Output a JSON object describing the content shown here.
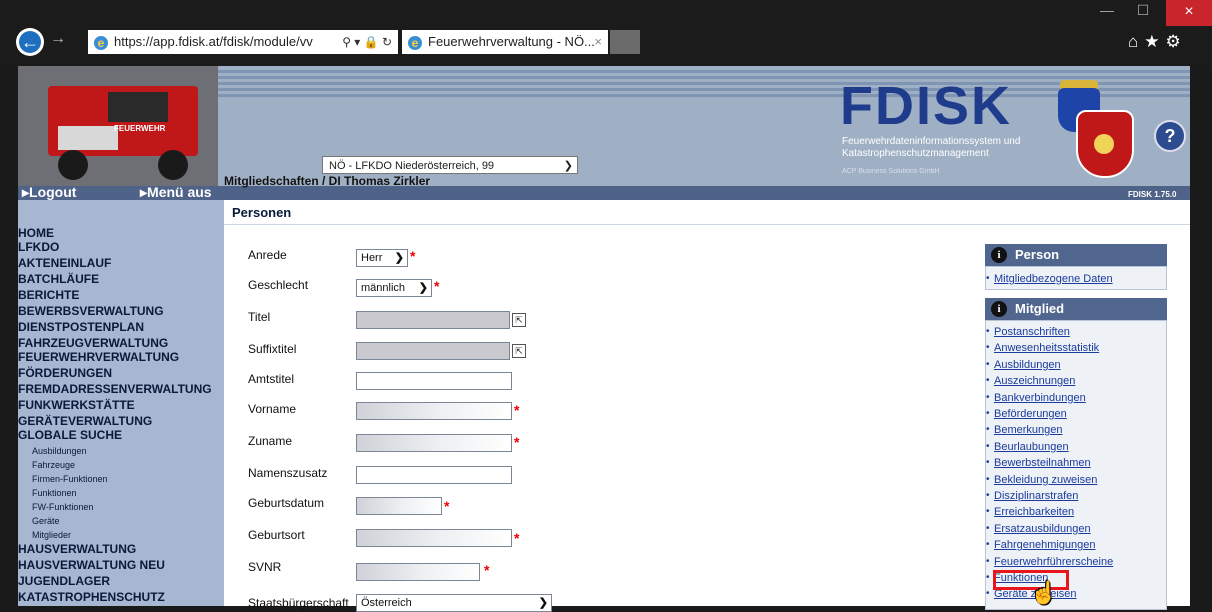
{
  "browser": {
    "url": "https://app.fdisk.at/fdisk/module/vv",
    "tab_title": "Feuerwehrverwaltung - NÖ...",
    "tab_close": "×",
    "back": "←",
    "forward": "→",
    "minimize": "—",
    "maximize": "☐",
    "close": "×",
    "toolbar_icons": "⌂★⚙",
    "address_icons": "⚲ ▾ 🔒 ↻"
  },
  "header": {
    "logo": "FDISK",
    "subtitle_line1": "Feuerwehrdateninformationssystem und",
    "subtitle_line2": "Katastrophenschutzmanagement",
    "acp": "ACP Business Solutions GmbH",
    "org_select": "NÖ - LFKDO Niederösterreich, 99",
    "breadcrumb": "Mitgliedschaften / DI Thomas Zirkler",
    "logout": "Logout",
    "menu_aus": "Menü aus",
    "version": "FDISK 1.75.0",
    "help": "?",
    "truck_label": "FEUERWEHR"
  },
  "sidebar": {
    "items": [
      "HOME",
      "LFKDO",
      "AKTENEINLAUF",
      "BATCHLÄUFE",
      "BERICHTE",
      "BEWERBSVERWALTUNG",
      "DIENSTPOSTENPLAN",
      "FAHRZEUGVERWALTUNG",
      "FEUERWEHRVERWALTUNG",
      "FÖRDERUNGEN",
      "FREMDADRESSENVERWALTUNG",
      "FUNKWERKSTÄTTE",
      "GERÄTEVERWALTUNG",
      "GLOBALE SUCHE"
    ],
    "subitems": [
      "Ausbildungen",
      "Fahrzeuge",
      "Firmen-Funktionen",
      "Funktionen",
      "FW-Funktionen",
      "Geräte",
      "Mitglieder"
    ],
    "items2": [
      "HAUSVERWALTUNG",
      "HAUSVERWALTUNG NEU",
      "JUGENDLAGER",
      "KATASTROPHENSCHUTZ"
    ]
  },
  "main": {
    "title": "Personen",
    "labels": {
      "anrede": "Anrede",
      "geschlecht": "Geschlecht",
      "titel": "Titel",
      "suffixtitel": "Suffixtitel",
      "amtstitel": "Amtstitel",
      "vorname": "Vorname",
      "zuname": "Zuname",
      "namenszusatz": "Namenszusatz",
      "geburtsdatum": "Geburtsdatum",
      "geburtsort": "Geburtsort",
      "svnr": "SVNR",
      "staatsbuergerschaft": "Staatsbürgerschaft"
    },
    "values": {
      "anrede": "Herr",
      "geschlecht": "männlich",
      "staatsbuergerschaft": "Österreich"
    },
    "required_mark": "*",
    "picker_glyph": "⇱"
  },
  "right_panel": {
    "person_title": "Person",
    "person_links": [
      "Mitgliedbezogene Daten"
    ],
    "mitglied_title": "Mitglied",
    "mitglied_links": [
      "Postanschriften",
      "Anwesenheitsstatistik",
      "Ausbildungen",
      "Auszeichnungen",
      "Bankverbindungen",
      "Beförderungen",
      "Bemerkungen",
      "Beurlaubungen",
      "Bewerbsteilnahmen",
      "Bekleidung zuweisen",
      "Disziplinarstrafen",
      "Erreichbarkeiten",
      "Ersatzausbildungen",
      "Fahrgenehmigungen",
      "Feuerwehrführerscheine",
      "Funktionen",
      "Geräte zuweisen"
    ],
    "info_glyph": "i",
    "bullet": "•"
  },
  "cursor": "☝"
}
